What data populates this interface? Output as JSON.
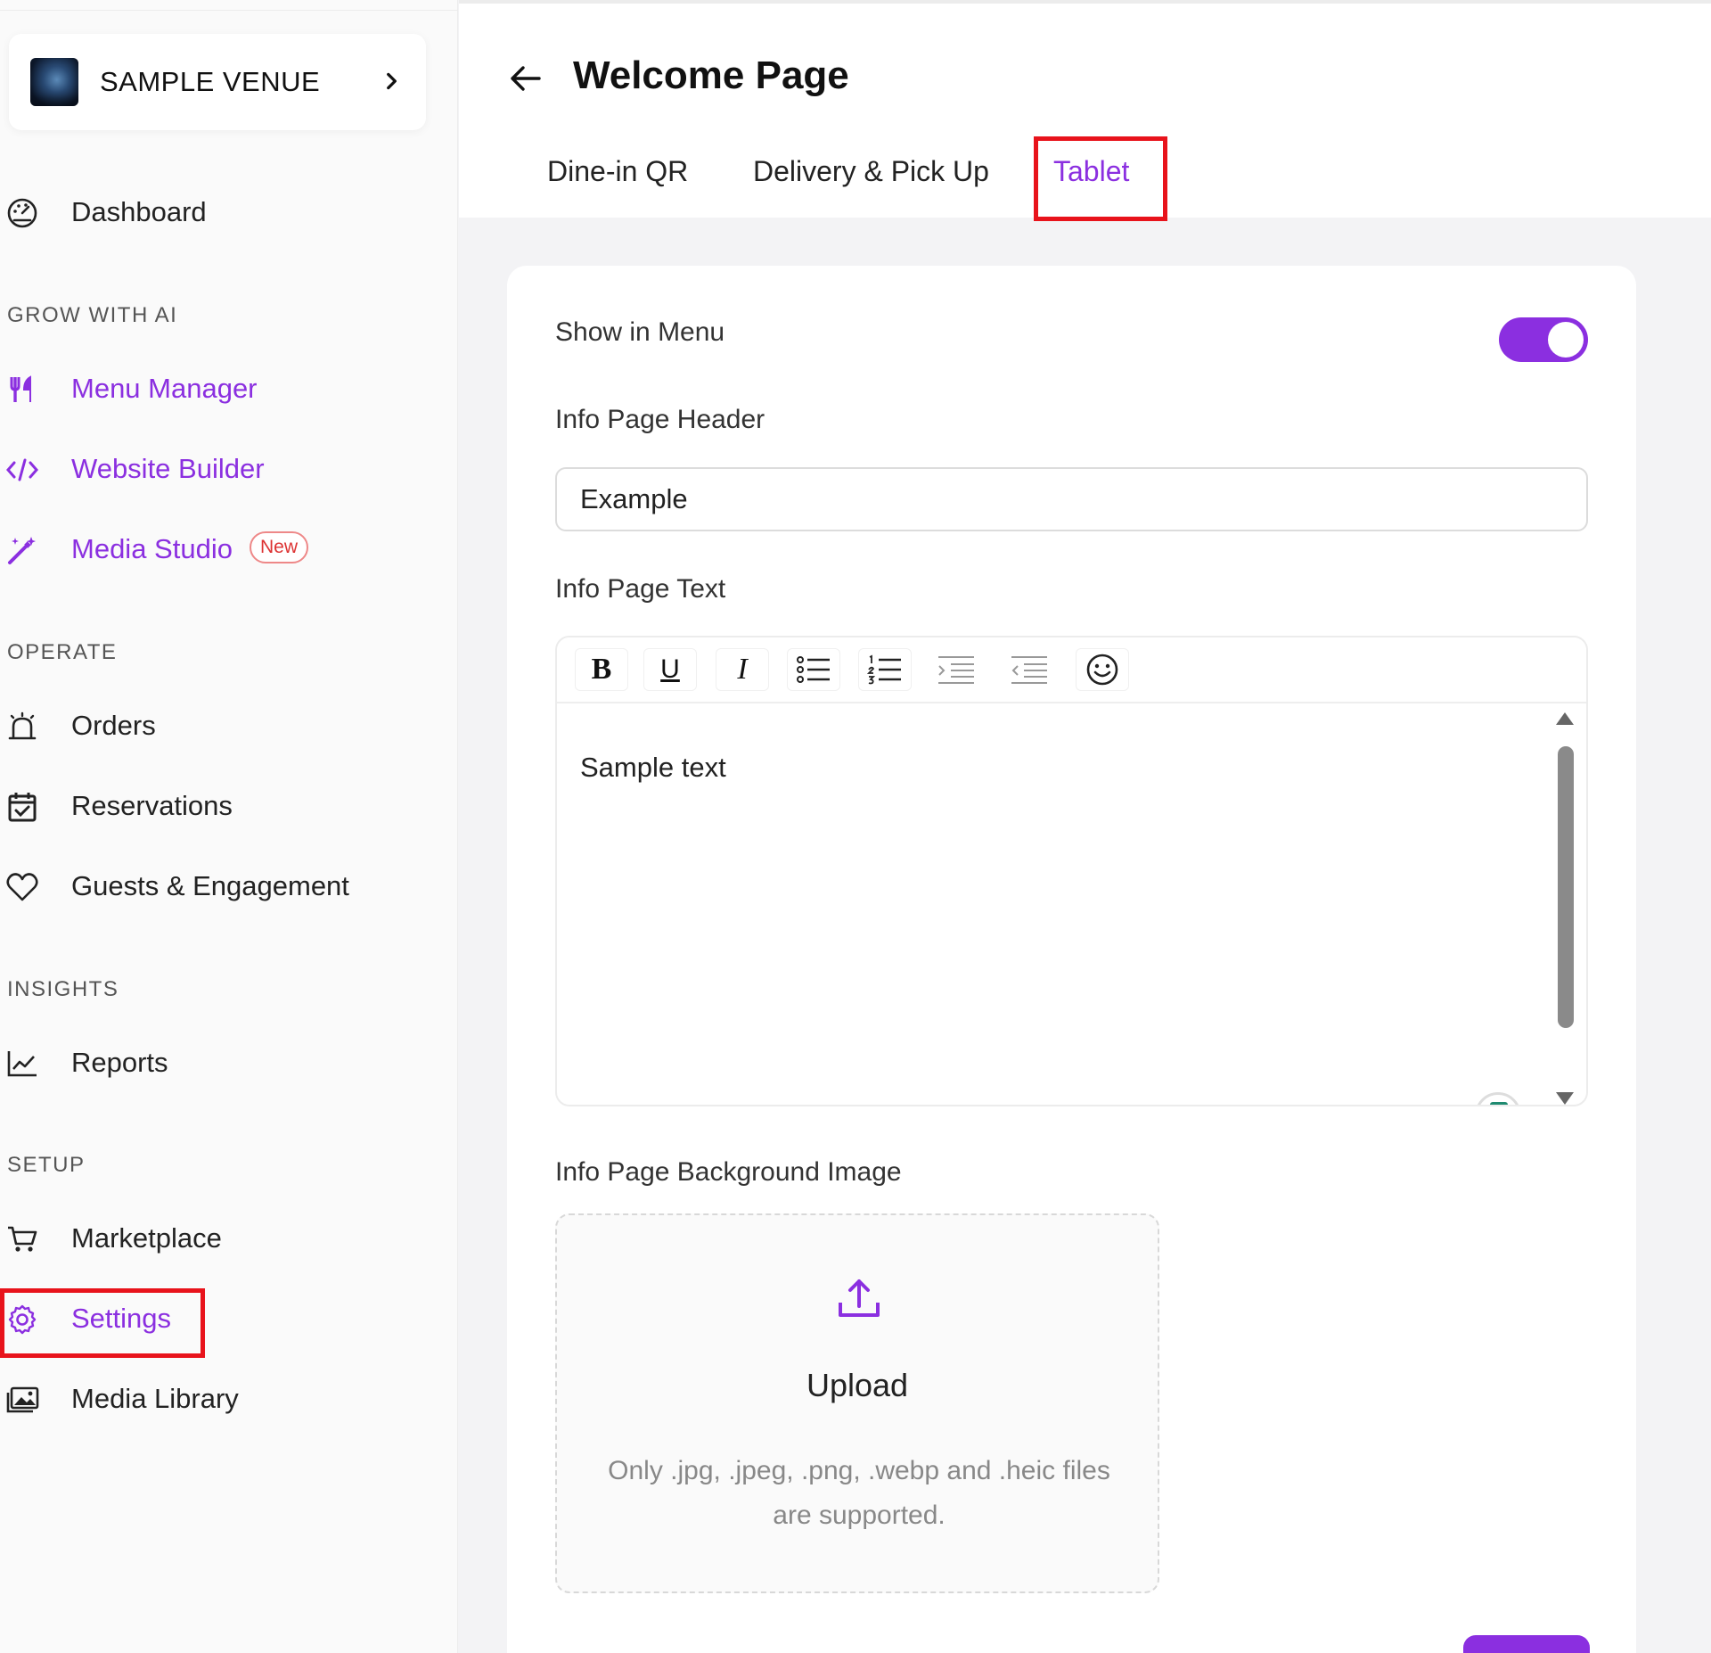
{
  "venue": {
    "name": "SAMPLE VENUE"
  },
  "sidebar": {
    "dashboard": "Dashboard",
    "sections": {
      "grow": "GROW WITH AI",
      "operate": "OPERATE",
      "insights": "INSIGHTS",
      "setup": "SETUP"
    },
    "items": {
      "menu_manager": "Menu Manager",
      "website_builder": "Website Builder",
      "media_studio": "Media Studio",
      "media_studio_badge": "New",
      "orders": "Orders",
      "reservations": "Reservations",
      "guests": "Guests & Engagement",
      "reports": "Reports",
      "marketplace": "Marketplace",
      "settings": "Settings",
      "media_library": "Media Library"
    }
  },
  "header": {
    "title": "Welcome Page",
    "tabs": [
      "Dine-in QR",
      "Delivery & Pick Up",
      "Tablet"
    ],
    "active_tab": "Tablet"
  },
  "form": {
    "show_in_menu_label": "Show in Menu",
    "show_in_menu_on": true,
    "header_label": "Info Page Header",
    "header_value": "Example",
    "text_label": "Info Page Text",
    "text_value": "Sample text",
    "toolbar": {
      "bold": "B",
      "underline": "U",
      "italic": "I",
      "buttons": [
        "bold-button",
        "underline-button",
        "italic-button",
        "bullet-list-button",
        "numbered-list-button",
        "indent-button",
        "outdent-button",
        "emoji-button"
      ]
    },
    "bg_image_label": "Info Page Background Image",
    "upload_title": "Upload",
    "upload_note": "Only .jpg, .jpeg, .png, .webp and .heic files are supported."
  },
  "colors": {
    "accent": "#8b2fe0",
    "highlight": "#e8131b",
    "badge": "#dd3333"
  }
}
